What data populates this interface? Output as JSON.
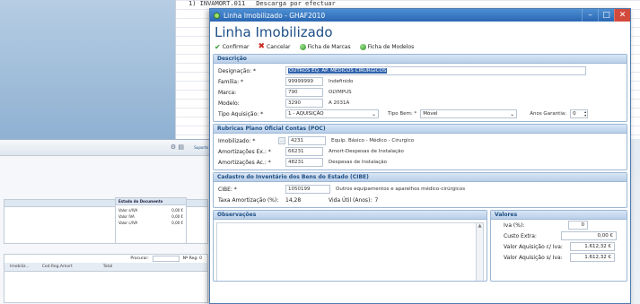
{
  "background_top": {
    "row_code": "1)  INVAMORT.011",
    "row_desc": "Descarga por efectuar"
  },
  "background_bottom": {
    "toolbar_label": "Suporte",
    "panel_right_title": "Estado do Documento",
    "panel_right_rows": [
      {
        "label": "Valor s/IVA",
        "value": "0,00 €"
      },
      {
        "label": "Valor IVA",
        "value": "0,00 €"
      },
      {
        "label": "Valor c/IVA",
        "value": "0,00 €"
      }
    ],
    "grid_headers": [
      "Imobiliz...",
      "Cod.Reg.Amort",
      "Total"
    ],
    "search_label": "Procurar:",
    "search_extra": "Nº Reg: 0"
  },
  "dialog": {
    "title": "Linha Imobilizado - GHAF2010",
    "heading": "Linha Imobilizado",
    "actions": {
      "confirm": "Confirmar",
      "cancel": "Cancelar",
      "marks": "Ficha de Marcas",
      "models": "Ficha de Modelos"
    },
    "descricao": {
      "title": "Descrição",
      "designacao_label": "Designação: *",
      "designacao_value": "OUTROS EQ. AP. MEDICOS CIRURGICOS",
      "familia_label": "Família: *",
      "familia_value": "99999999",
      "familia_desc": "Indefinido",
      "marca_label": "Marca:",
      "marca_value": "790",
      "marca_desc": "OLYMPUS",
      "modelo_label": "Modelo:",
      "modelo_value": "3290",
      "modelo_desc": "A 2031A",
      "tipo_aquisicao_label": "Tipo Aquisição: *",
      "tipo_aquisicao_value": "1 - AQUISIÇÃO",
      "tipo_bem_label": "Tipo Bem: *",
      "tipo_bem_value": "Móvel",
      "anos_garantia_label": "Anos Garantia:",
      "anos_garantia_value": "0"
    },
    "poc": {
      "title": "Rubricas Plano Oficial Contas (POC)",
      "imobilizado_label": "Imobilizado: *",
      "imobilizado_value": "4231",
      "imobilizado_desc": "Equip. Básico - Médico - Cirurgico",
      "amort_ex_label": "Amortizações Ex.: *",
      "amort_ex_value": "66231",
      "amort_ex_desc": "Amort-Despesas de Instalação",
      "amort_ac_label": "Amortizações Ac.: *",
      "amort_ac_value": "48231",
      "amort_ac_desc": "Despesas de Instalação"
    },
    "cibe": {
      "title": "Cadastro do Inventário dos Bens do Estado (CIBE)",
      "cibe_label": "CIBE: *",
      "cibe_value": "1050199",
      "cibe_desc": "Outros equipamentos e aparelhos médico-cirúrgicos",
      "taxa_label": "Taxa Amortização (%):",
      "taxa_value": "14,28",
      "vida_util_label": "Vida Útil (Anos):",
      "vida_util_value": "7"
    },
    "observacoes": {
      "title": "Observações"
    },
    "valores": {
      "title": "Valores",
      "iva_label": "Iva (%):",
      "iva_value": "0",
      "custo_extra_label": "Custo Extra:",
      "custo_extra_value": "0,00 €",
      "valor_civa_label": "Valor Aquisição c/ Iva:",
      "valor_civa_value": "1.612,32 €",
      "valor_siva_label": "Valor Aquisição s/ Iva:",
      "valor_siva_value": "1.612,32 €"
    }
  }
}
